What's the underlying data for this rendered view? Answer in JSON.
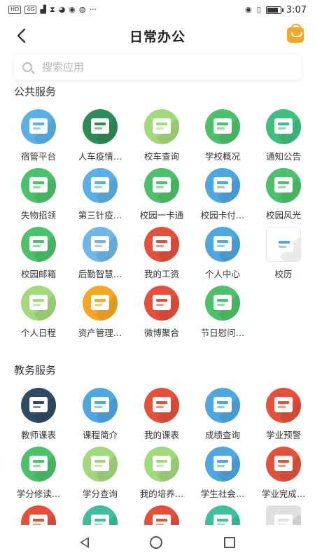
{
  "status_bar": {
    "chips": [
      "HD",
      "4G"
    ],
    "icons": [
      "signal-icon",
      "hourglass-icon",
      "wechat-icon",
      "browser-icon",
      "app-icon",
      "more-icon"
    ],
    "more": "···",
    "time": "3:07",
    "battery_level": 0.85
  },
  "header": {
    "title": "日常办公",
    "back_icon": "chevron-left-icon",
    "bag_icon": "shopping-bag-icon",
    "accent": "#f5a623"
  },
  "search": {
    "placeholder": "搜索应用"
  },
  "sections": [
    {
      "title": "公共服务",
      "apps": [
        {
          "label": "宿管平台",
          "icon": "dorm-house-icon",
          "color": "#5ab0e6"
        },
        {
          "label": "人车疫情…",
          "icon": "vehicle-badge-icon",
          "color": "#2e8b57"
        },
        {
          "label": "校车查询",
          "icon": "bus-icon",
          "color": "#a3d97d"
        },
        {
          "label": "学校概况",
          "icon": "school-building-icon",
          "color": "#4cc06a"
        },
        {
          "label": "通知公告",
          "icon": "notice-board-icon",
          "color": "#3fbf7f"
        },
        {
          "label": "失物招领",
          "icon": "lost-found-icon",
          "color": "#4cc06a"
        },
        {
          "label": "第三针疫…",
          "icon": "vaccine-form-icon",
          "color": "#5ab0e6"
        },
        {
          "label": "校园一卡通",
          "icon": "campus-card-icon",
          "color": "#4cc06a"
        },
        {
          "label": "校园卡付…",
          "icon": "card-payment-icon",
          "color": "#4fa7e0"
        },
        {
          "label": "校园风光",
          "icon": "campus-scenery-icon",
          "color": "#4cc06a"
        },
        {
          "label": "校园邮箱",
          "icon": "mail-icon",
          "color": "#4cc06a"
        },
        {
          "label": "后勤智慧…",
          "icon": "logistics-icon",
          "color": "#6fb7e8"
        },
        {
          "label": "我的工资",
          "icon": "salary-icon",
          "color": "#e4503c"
        },
        {
          "label": "个人中心",
          "icon": "person-icon",
          "color": "#4fa7e0"
        },
        {
          "label": "校历",
          "icon": "calendar-icon",
          "color": "#ffffff"
        },
        {
          "label": "个人日程",
          "icon": "schedule-icon",
          "color": "#a3d97d"
        },
        {
          "label": "资产管理…",
          "icon": "asset-book-icon",
          "color": "#f5a623"
        },
        {
          "label": "微博聚合",
          "icon": "open-book-icon",
          "color": "#e4503c"
        },
        {
          "label": "节日慰问…",
          "icon": "holiday-gift-icon",
          "color": "#4cc06a"
        }
      ]
    },
    {
      "title": "教务服务",
      "apps": [
        {
          "label": "教师课表",
          "icon": "books-icon",
          "color": "#2f4a63"
        },
        {
          "label": "课程简介",
          "icon": "course-doc-icon",
          "color": "#4fa7e0"
        },
        {
          "label": "我的课表",
          "icon": "blackboard-icon",
          "color": "#e4503c"
        },
        {
          "label": "成绩查询",
          "icon": "grade-search-icon",
          "color": "#4fa7e0"
        },
        {
          "label": "学业预警",
          "icon": "student-warning-icon",
          "color": "#e4503c"
        },
        {
          "label": "学分修读…",
          "icon": "credit-doc-icon",
          "color": "#4cc06a"
        },
        {
          "label": "学分查询",
          "icon": "credit-search-icon",
          "color": "#a3d97d"
        },
        {
          "label": "我的培养…",
          "icon": "training-plan-icon",
          "color": "#a3d97d"
        },
        {
          "label": "学生社会…",
          "icon": "student-practice-icon",
          "color": "#4fa7e0"
        },
        {
          "label": "学业完成…",
          "icon": "study-complete-icon",
          "color": "#e4503c"
        },
        {
          "label": "",
          "icon": "books-search-icon",
          "color": "#e4503c"
        },
        {
          "label": "",
          "icon": "exam-seat-icon",
          "color": "#3fbf9f"
        },
        {
          "label": "",
          "icon": "document-list-icon",
          "color": "#e4503c"
        },
        {
          "label": "",
          "icon": "exam-seat-icon",
          "color": "#3fbf9f"
        },
        {
          "label": "",
          "icon": "report-table-icon",
          "color": "#e0e0e0"
        }
      ]
    }
  ]
}
